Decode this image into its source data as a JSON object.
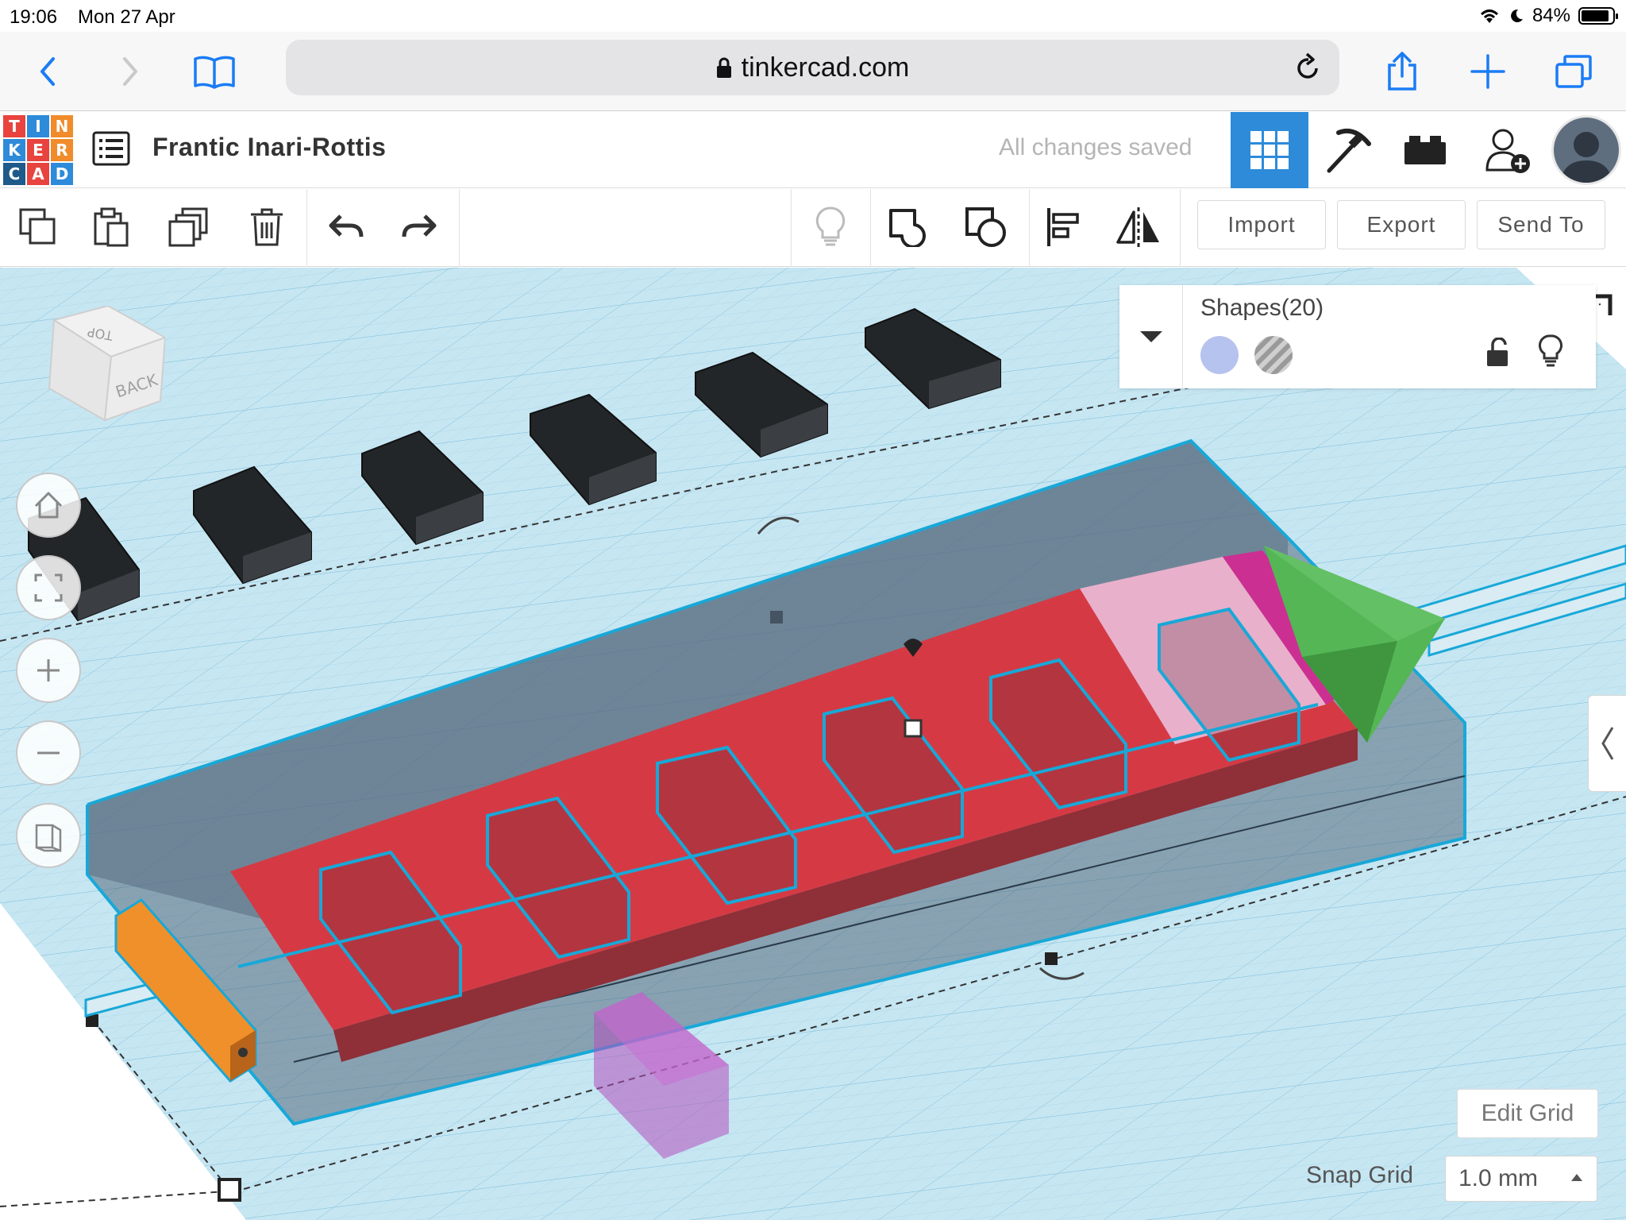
{
  "status_bar": {
    "time": "19:06",
    "date": "Mon 27 Apr",
    "battery": "84%"
  },
  "browser": {
    "url": "tinkercad.com"
  },
  "app": {
    "logo_letters": [
      "T",
      "I",
      "N",
      "K",
      "E",
      "R",
      "C",
      "A",
      "D"
    ],
    "logo_colors": [
      "#e8433e",
      "#2d8bd9",
      "#f08c2b",
      "#2d8bd9",
      "#e8433e",
      "#f08c2b",
      "#1e5a8a",
      "#e8433e",
      "#2d8bd9"
    ],
    "design_title": "Frantic Inari-Rottis",
    "save_status": "All changes saved"
  },
  "toolbar": {
    "import_label": "Import",
    "export_label": "Export",
    "send_to_label": "Send To"
  },
  "inspector": {
    "title": "Shapes(20)"
  },
  "navcube": {
    "top_label": "TOP",
    "back_label": "BACK"
  },
  "grid": {
    "edit_grid_label": "Edit Grid",
    "snap_grid_label": "Snap Grid",
    "snap_grid_value": "1.0 mm"
  },
  "colors": {
    "accent": "#2d8bd9",
    "workplane": "#c6e6f2",
    "grid_line": "#9fd0e6",
    "selection": "#1ab0e0"
  }
}
